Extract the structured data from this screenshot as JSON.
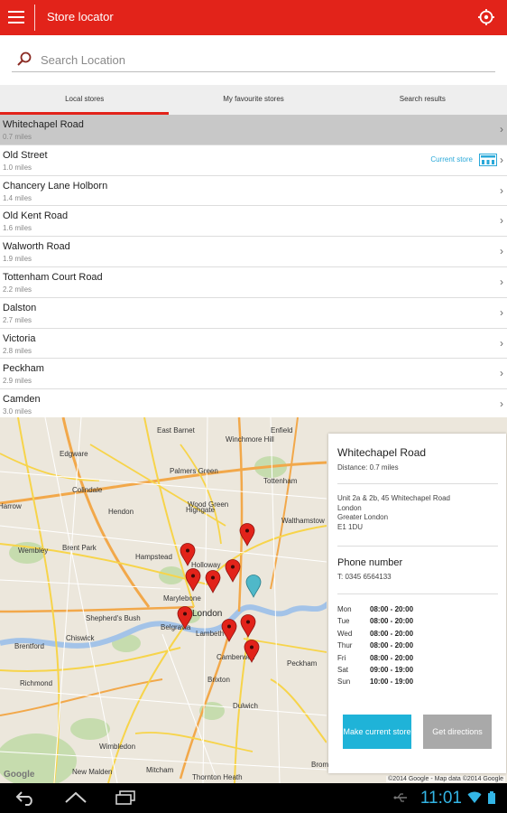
{
  "app": {
    "title": "Store locator"
  },
  "search": {
    "placeholder": "Search Location"
  },
  "tabs": [
    {
      "label": "Local stores",
      "active": true
    },
    {
      "label": "My favourite stores",
      "active": false
    },
    {
      "label": "Search results",
      "active": false
    }
  ],
  "stores": [
    {
      "name": "Whitechapel Road",
      "distance": "0.7 miles",
      "selected": true
    },
    {
      "name": "Old Street",
      "distance": "1.0 miles",
      "current_label": "Current store"
    },
    {
      "name": "Chancery Lane Holborn",
      "distance": "1.4 miles"
    },
    {
      "name": "Old Kent Road",
      "distance": "1.6 miles"
    },
    {
      "name": "Walworth Road",
      "distance": "1.9 miles"
    },
    {
      "name": "Tottenham Court Road",
      "distance": "2.2 miles"
    },
    {
      "name": "Dalston",
      "distance": "2.7 miles"
    },
    {
      "name": "Victoria",
      "distance": "2.8 miles"
    },
    {
      "name": "Peckham",
      "distance": "2.9 miles"
    },
    {
      "name": "Camden",
      "distance": "3.0 miles"
    }
  ],
  "map": {
    "labels": [
      "East Barnet",
      "Edgware",
      "Palmers Green",
      "Colindale",
      "Tottenham",
      "Wood Green",
      "Hendon",
      "Winchmore Hill",
      "Enfield",
      "Walthamstow",
      "Hampstead",
      "Highgate",
      "Harrow",
      "Wembley",
      "Brent Park",
      "Holloway",
      "Marylebone",
      "London",
      "Shepherd's Bush",
      "Chiswick",
      "Brentford",
      "Belgravia",
      "Lambeth",
      "Camberwell",
      "Brixton",
      "Richmond",
      "Dulwich",
      "Mitcham",
      "Thornton Heath",
      "New Malden",
      "Bromley",
      "Peckham",
      "Wimbledon"
    ],
    "google": "Google",
    "attribution": "©2014 Google - Map data ©2014 Google",
    "colors": {
      "pin": "#e2231a",
      "user_pin": "#4fb8c9"
    }
  },
  "panel": {
    "name": "Whitechapel Road",
    "distance": "Distance: 0.7 miles",
    "address": [
      "Unit 2a & 2b, 45 Whitechapel Road",
      "London",
      "Greater London",
      "E1 1DU"
    ],
    "phone_heading": "Phone number",
    "phone": "T: 0345 6564133",
    "hours": [
      {
        "day": "Mon",
        "time": "08:00 - 20:00"
      },
      {
        "day": "Tue",
        "time": "08:00 - 20:00"
      },
      {
        "day": "Wed",
        "time": "08:00 - 20:00"
      },
      {
        "day": "Thur",
        "time": "08:00 - 20:00"
      },
      {
        "day": "Fri",
        "time": "08:00 - 20:00"
      },
      {
        "day": "Sat",
        "time": "09:00 - 19:00"
      },
      {
        "day": "Sun",
        "time": "10:00 - 19:00"
      }
    ],
    "make_current_label": "Make current store",
    "directions_label": "Get directions"
  },
  "system": {
    "time": "11:01"
  },
  "colors": {
    "accent": "#e2231a",
    "button_primary": "#1fb3d8",
    "button_secondary": "#a9a9a9",
    "link": "#29a8d9"
  }
}
